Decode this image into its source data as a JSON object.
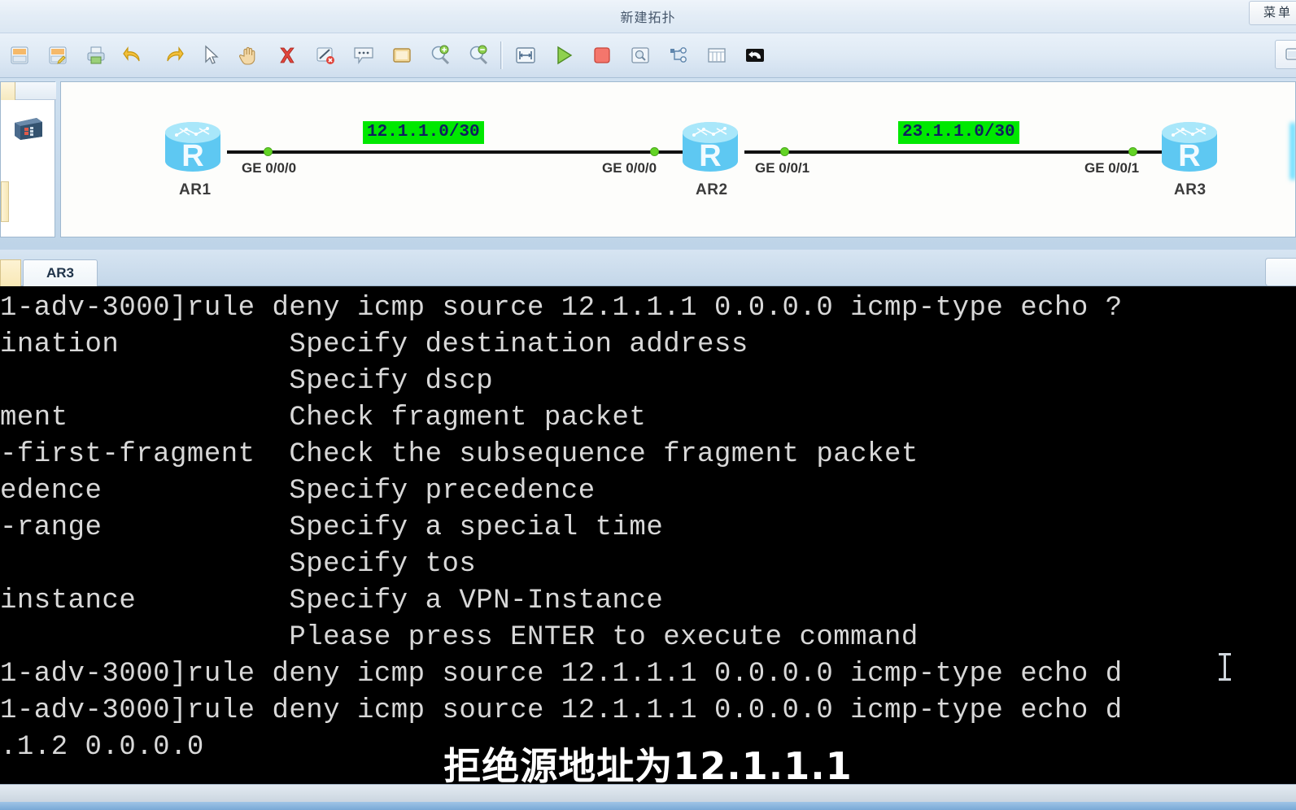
{
  "window": {
    "title": "新建拓扑",
    "menu_button": "菜单"
  },
  "toolbar": {
    "icons": [
      {
        "name": "new-file-icon",
        "label": "新建"
      },
      {
        "name": "save-icon",
        "label": "保存"
      },
      {
        "name": "print-icon",
        "label": "打印"
      },
      {
        "name": "undo-icon",
        "label": "撤销"
      },
      {
        "name": "redo-icon",
        "label": "重做"
      },
      {
        "name": "cursor-select-icon",
        "label": "选择"
      },
      {
        "name": "hand-pan-icon",
        "label": "平移"
      },
      {
        "name": "delete-icon",
        "label": "删除"
      },
      {
        "name": "remove-cable-icon",
        "label": "删除连线"
      },
      {
        "name": "comment-icon",
        "label": "注释"
      },
      {
        "name": "rectangle-icon",
        "label": "矩形"
      },
      {
        "name": "zoom-in-icon",
        "label": "放大"
      },
      {
        "name": "zoom-out-icon",
        "label": "缩小"
      },
      {
        "name": "fit-window-icon",
        "label": "适应窗口"
      },
      {
        "name": "start-device-icon",
        "label": "开启设备"
      },
      {
        "name": "stop-device-icon",
        "label": "关闭设备"
      },
      {
        "name": "capture-packet-icon",
        "label": "数据抓包"
      },
      {
        "name": "topology-tree-icon",
        "label": "拓扑树"
      },
      {
        "name": "grid-icon",
        "label": "网格"
      },
      {
        "name": "console-icon",
        "label": "控制台"
      }
    ],
    "right_button": "restore-window-icon"
  },
  "workspace": {
    "left_panel": {
      "device_icon": "switch-device-icon"
    },
    "topology": {
      "routers": [
        {
          "name": "AR1",
          "glyph": "R"
        },
        {
          "name": "AR2",
          "glyph": "R"
        },
        {
          "name": "AR3",
          "glyph": "R"
        }
      ],
      "interfaces": [
        {
          "label": "GE 0/0/0"
        },
        {
          "label": "GE 0/0/0"
        },
        {
          "label": "GE 0/0/1"
        },
        {
          "label": "GE 0/0/1"
        }
      ],
      "networks": [
        {
          "cidr": "12.1.1.0/30"
        },
        {
          "cidr": "23.1.1.0/30"
        }
      ],
      "colors": {
        "network_label_bg": "#00e800",
        "network_label_fg": "#0f1f5e",
        "link": "#111111",
        "port_dot": "#63d425",
        "router_body": "#5ec8f2"
      }
    }
  },
  "tabbar": {
    "tabs": [
      {
        "label": "AR3",
        "selected": true
      }
    ]
  },
  "terminal": {
    "lines": [
      "1-adv-3000]rule deny icmp source 12.1.1.1 0.0.0.0 icmp-type echo ?",
      "ination          Specify destination address",
      "                 Specify dscp",
      "ment             Check fragment packet",
      "-first-fragment  Check the subsequence fragment packet",
      "edence           Specify precedence",
      "-range           Specify a special time",
      "                 Specify tos",
      "instance         Specify a VPN-Instance",
      "                 Please press ENTER to execute command",
      "1-adv-3000]rule deny icmp source 12.1.1.1 0.0.0.0 icmp-type echo d",
      "1-adv-3000]rule deny icmp source 12.1.1.1 0.0.0.0 icmp-type echo d",
      ".1.2 0.0.0.0"
    ],
    "colors": {
      "background": "#000000",
      "foreground": "#d8d8d8"
    }
  },
  "subtitle": {
    "text": "拒绝源地址为12.1.1.1"
  }
}
